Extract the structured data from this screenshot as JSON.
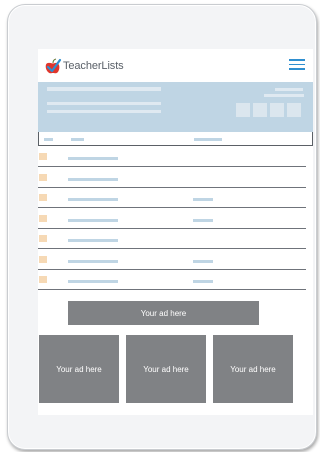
{
  "app": {
    "logo_text": "TeacherLists",
    "brand_color": "#2f8fd0",
    "accent_apple": "#e0362c"
  },
  "table": {
    "rows": [
      {
        "has_second_col": false
      },
      {
        "has_second_col": false
      },
      {
        "has_second_col": true
      },
      {
        "has_second_col": true
      },
      {
        "has_second_col": false
      },
      {
        "has_second_col": true
      },
      {
        "has_second_col": true
      }
    ]
  },
  "ads": {
    "banner_label": "Your ad here",
    "tile_labels": [
      "Your ad here",
      "Your ad here",
      "Your ad here"
    ]
  }
}
